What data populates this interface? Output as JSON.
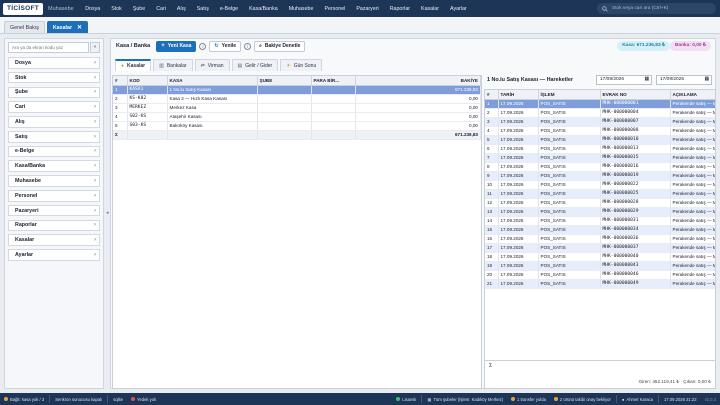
{
  "app": {
    "logo": "TİCİSOFT",
    "module": "Muhasebe"
  },
  "menu": [
    "Dosya",
    "Stok",
    "Şube",
    "Cari",
    "Alış",
    "Satış",
    "e-Belge",
    "Kasa/Banka",
    "Muhasebe",
    "Personel",
    "Pazaryeri",
    "Raporlar",
    "Kasalar",
    "Ayarlar"
  ],
  "search": {
    "placeholder": "Stok veya cari ara (Ctrl+K)"
  },
  "tabs": [
    {
      "label": "Genel Bakış"
    },
    {
      "label": "Kasalar"
    }
  ],
  "sidebar": {
    "search_placeholder": "Ara ya da ekran kodu yaz",
    "collapse_label": "«",
    "items": [
      "Dosya",
      "Stok",
      "Şube",
      "Cari",
      "Alış",
      "Satış",
      "e-Belge",
      "Kasa/Banka",
      "Muhasebe",
      "Personel",
      "Pazaryeri",
      "Raporlar",
      "Kasalar",
      "Ayarlar"
    ]
  },
  "toolbar": {
    "breadcrumb": "Kasa / Banka",
    "new_label": "Yeni Kasa",
    "refresh_label": "Yenile",
    "check_label": "Bakiye Denetle",
    "kasa_total": "Kasa: 671.236,83 ₺",
    "banka_total": "Banka: 0,00 ₺"
  },
  "subtabs": [
    "Kasalar",
    "Bankalar",
    "Virman",
    "Gelir / Gider",
    "Gün Sonu"
  ],
  "left_table": {
    "headers": [
      "#",
      "KOD",
      "KASA",
      "ŞUBE",
      "PARA BİR...",
      "BAKİYE"
    ],
    "rows": [
      {
        "n": "1",
        "kod": "KASA1",
        "kasa": "1 No.lu Satış Kasası",
        "sube": "",
        "para": "",
        "bakiye": "671.236,83"
      },
      {
        "n": "2",
        "kod": "KS-K02",
        "kasa": "Kasa 2 — Hızlı Kasa Kasası",
        "sube": "",
        "para": "",
        "bakiye": "0,00"
      },
      {
        "n": "3",
        "kod": "MERKEZ",
        "kasa": "Merkez Kasa",
        "sube": "",
        "para": "",
        "bakiye": "0,00"
      },
      {
        "n": "4",
        "kod": "S02-KS",
        "kasa": "Ataşehir Kasası",
        "sube": "",
        "para": "",
        "bakiye": "0,00"
      },
      {
        "n": "5",
        "kod": "S03-KS",
        "kasa": "Bakırköy Kasası",
        "sube": "",
        "para": "",
        "bakiye": "0,00"
      }
    ],
    "total_symbol": "Σ",
    "total": "671.236,83"
  },
  "right_panel": {
    "title": "1 No.lu Satış Kasası — Hareketler",
    "date_from": "17/09/2026",
    "date_to": "17/09/2026",
    "headers": [
      "#",
      "TARİH",
      "İŞLEM",
      "EVRAK NO",
      "AÇIKLAMA"
    ],
    "rows": [
      [
        "1",
        "17.09.2026",
        "POS_SATIS",
        "MHK-000000001",
        "Perakende satış — MH"
      ],
      [
        "2",
        "17.09.2026",
        "POS_SATIS",
        "MHK-000000004",
        "Perakende satış — MH"
      ],
      [
        "3",
        "17.09.2026",
        "POS_SATIS",
        "MHK-000000007",
        "Perakende satış — MH"
      ],
      [
        "4",
        "17.09.2026",
        "POS_SATIS",
        "MHK-000000008",
        "Perakende satış — MH"
      ],
      [
        "5",
        "17.09.2026",
        "POS_SATIS",
        "MHK-000000010",
        "Perakende satış — MH"
      ],
      [
        "6",
        "17.09.2026",
        "POS_SATIS",
        "MHK-000000013",
        "Perakende satış — MH"
      ],
      [
        "7",
        "17.09.2026",
        "POS_SATIS",
        "MHK-000000015",
        "Perakende satış — MH"
      ],
      [
        "8",
        "17.09.2026",
        "POS_SATIS",
        "MHK-000000016",
        "Perakende satış — MH"
      ],
      [
        "9",
        "17.09.2026",
        "POS_SATIS",
        "MHK-000000019",
        "Perakende satış — MH"
      ],
      [
        "10",
        "17.09.2026",
        "POS_SATIS",
        "MHK-000000022",
        "Perakende satış — MH"
      ],
      [
        "11",
        "17.09.2026",
        "POS_SATIS",
        "MHK-000000025",
        "Perakende satış — MH"
      ],
      [
        "12",
        "17.09.2026",
        "POS_SATIS",
        "MHK-000000028",
        "Perakende satış — MH"
      ],
      [
        "13",
        "17.09.2026",
        "POS_SATIS",
        "MHK-000000029",
        "Perakende satış — MH"
      ],
      [
        "14",
        "17.09.2026",
        "POS_SATIS",
        "MHK-000000031",
        "Perakende satış — MH"
      ],
      [
        "15",
        "17.09.2026",
        "POS_SATIS",
        "MHK-000000034",
        "Perakende satış — MH"
      ],
      [
        "16",
        "17.09.2026",
        "POS_SATIS",
        "MHK-000000036",
        "Perakende satış — MH"
      ],
      [
        "17",
        "17.09.2026",
        "POS_SATIS",
        "MHK-000000037",
        "Perakende satış — MH"
      ],
      [
        "18",
        "17.09.2026",
        "POS_SATIS",
        "MHK-000000040",
        "Perakende satış — MH"
      ],
      [
        "19",
        "17.09.2026",
        "POS_SATIS",
        "MHK-000000043",
        "Perakende satış — MH"
      ],
      [
        "20",
        "17.09.2026",
        "POS_SATIS",
        "MHK-000000046",
        "Perakende satış — MH"
      ],
      [
        "21",
        "17.09.2026",
        "POS_SATIS",
        "MHK-000000049",
        "Perakende satış — MH"
      ]
    ],
    "total_symbol": "Σ",
    "summary": "Giren: 452.119,41 ₺ · Çıkan: 0,00 ₺"
  },
  "statusbar": {
    "left1": "Bağlı: kasa yok / 3",
    "left2": "Senkron sunucusu kapalı",
    "left3": "sqlite",
    "left4": "Yedek yok",
    "mid1": "Lisanslı",
    "mid2": "Tüm şubeler (İşlem: Kadıköy Merkez)",
    "mid3": "1 transfer yolda",
    "mid4": "2 ürünü takibi onay bekliyor",
    "user": "Ahmet Karaca",
    "clock": "17.09.2026 21:22",
    "version": "v2.0.3"
  },
  "colors": {
    "nav": "#1d3557",
    "accent": "#1d6fb8",
    "selected_row": "#7f9ddb",
    "alt_row": "#e6eefb"
  }
}
